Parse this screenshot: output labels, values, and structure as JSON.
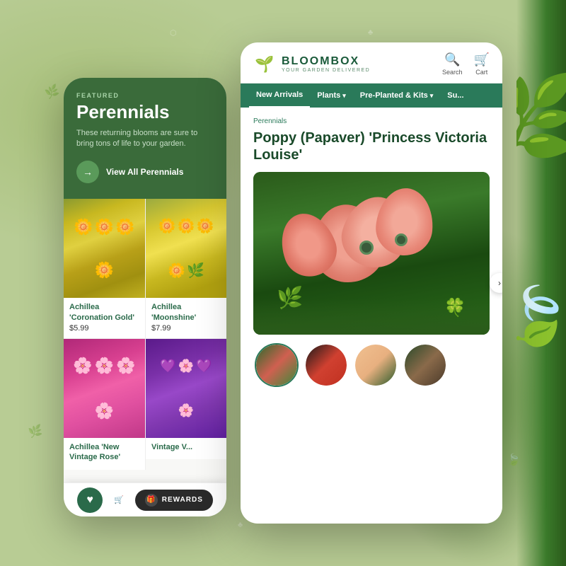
{
  "background": {
    "color": "#b8cc90"
  },
  "left_phone": {
    "featured": {
      "label": "FEATURED",
      "title": "Perennials",
      "description": "These returning blooms are sure to bring tons of life to your garden.",
      "cta": "View All Perennials"
    },
    "products": [
      {
        "name": "Achillea 'Coronation Gold'",
        "price": "$5.99",
        "color_class": "yellow-1"
      },
      {
        "name": "Achillea 'Moonshine'",
        "price": "$7.99",
        "color_class": "yellow-2"
      },
      {
        "name": "Achillea 'New Vintage Rose'",
        "price": "",
        "color_class": "pink-1"
      },
      {
        "name": "Vintage V...",
        "price": "",
        "color_class": "purple-1"
      }
    ],
    "bottom_bar": {
      "rewards_label": "REWARDS"
    }
  },
  "right_phone": {
    "header": {
      "brand": "BLOOMBOX",
      "tagline": "YOUR GARDEN DELIVERED",
      "search_label": "Search",
      "cart_label": "Cart"
    },
    "nav": [
      {
        "label": "New Arrivals",
        "active": true,
        "has_chevron": false
      },
      {
        "label": "Plants",
        "active": false,
        "has_chevron": true
      },
      {
        "label": "Pre-Planted & Kits",
        "active": false,
        "has_chevron": true
      },
      {
        "label": "Su...",
        "active": false,
        "has_chevron": false
      }
    ],
    "product": {
      "breadcrumb": "Perennials",
      "title": "Poppy (Papaver) 'Princess Victoria Louise'",
      "thumbnails": [
        {
          "label": "Poppy buds thumbnail"
        },
        {
          "label": "Poppy bloom close-up thumbnail"
        },
        {
          "label": "Poppy seed pod thumbnail"
        },
        {
          "label": "Poppy plant thumbnail"
        }
      ]
    }
  }
}
